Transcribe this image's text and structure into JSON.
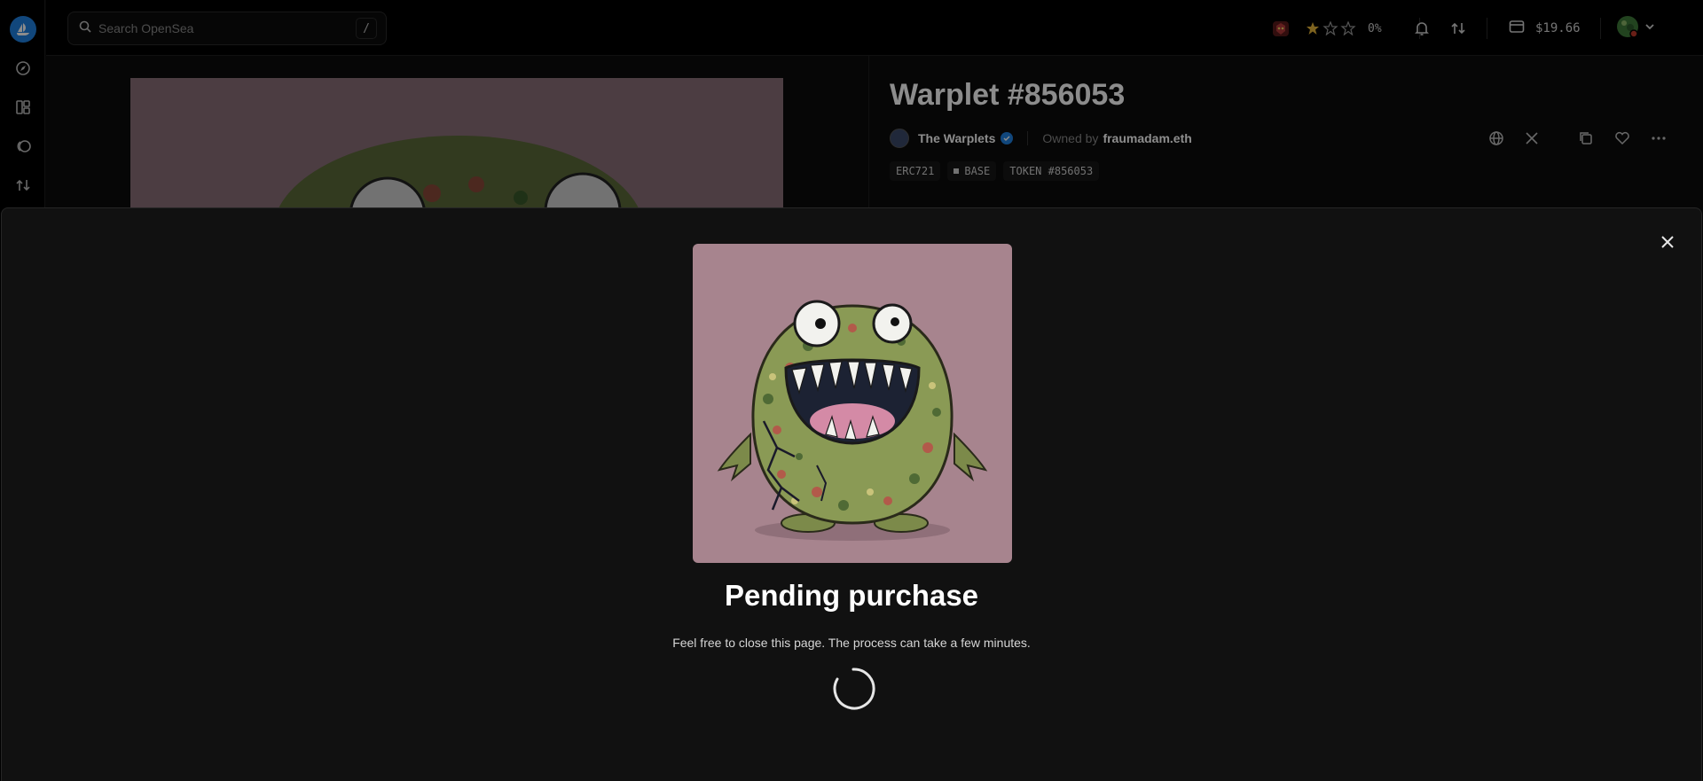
{
  "search": {
    "placeholder": "Search OpenSea",
    "shortcut": "/"
  },
  "header": {
    "rating_percent": "0%",
    "wallet_balance": "$19.66"
  },
  "item": {
    "title": "Warplet #856053",
    "collection": "The Warplets",
    "owned_by_label": "Owned by",
    "owner": "fraumadam.eth",
    "tags": [
      "ERC721",
      "BASE",
      "TOKEN #856053"
    ]
  },
  "modal": {
    "title": "Pending purchase",
    "subtitle": "Feel free to close this page. The process can take a few minutes."
  },
  "colors": {
    "accent": "#2081e2",
    "background": "#111111",
    "nft_bg": "#a7848e"
  }
}
